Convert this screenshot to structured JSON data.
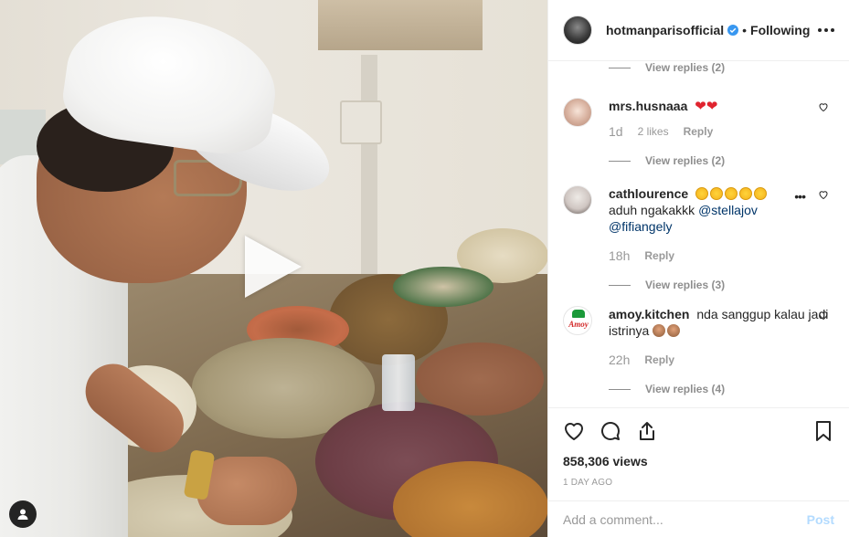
{
  "post": {
    "username": "hotmanparisofficial",
    "separator": "•",
    "follow_status": "Following",
    "views": "858,306 views",
    "date": "1 DAY AGO"
  },
  "comments_list": {
    "top_view_replies": "View replies (2)",
    "items": [
      {
        "user": "mrs.husnaaa",
        "emoji": "❤❤",
        "time": "1d",
        "likes": "2 likes",
        "reply": "Reply",
        "view_replies": "View replies (2)"
      },
      {
        "user": "cathlourence",
        "emoji_count": 5,
        "text": "aduh ngakakkk",
        "mention1": "@stellajov",
        "mention2": "@fifiangely",
        "time": "18h",
        "reply": "Reply",
        "view_replies": "View replies (3)"
      },
      {
        "user": "amoy.kitchen",
        "text": "nda sanggup kalau jadi istrinya",
        "avatar_text": "Amoy",
        "time": "22h",
        "reply": "Reply",
        "view_replies": "View replies (4)"
      }
    ]
  },
  "add_comment": {
    "placeholder": "Add a comment...",
    "post_label": "Post"
  },
  "colors": {
    "verified": "#3897f0",
    "post_disabled": "#b3dbff",
    "mention": "#003569",
    "muted": "#8e8e8e"
  },
  "icons": [
    "play-icon",
    "user-tag-icon",
    "verified-badge-icon",
    "more-options-icon",
    "heart-icon",
    "comment-icon",
    "share-icon",
    "bookmark-icon"
  ]
}
